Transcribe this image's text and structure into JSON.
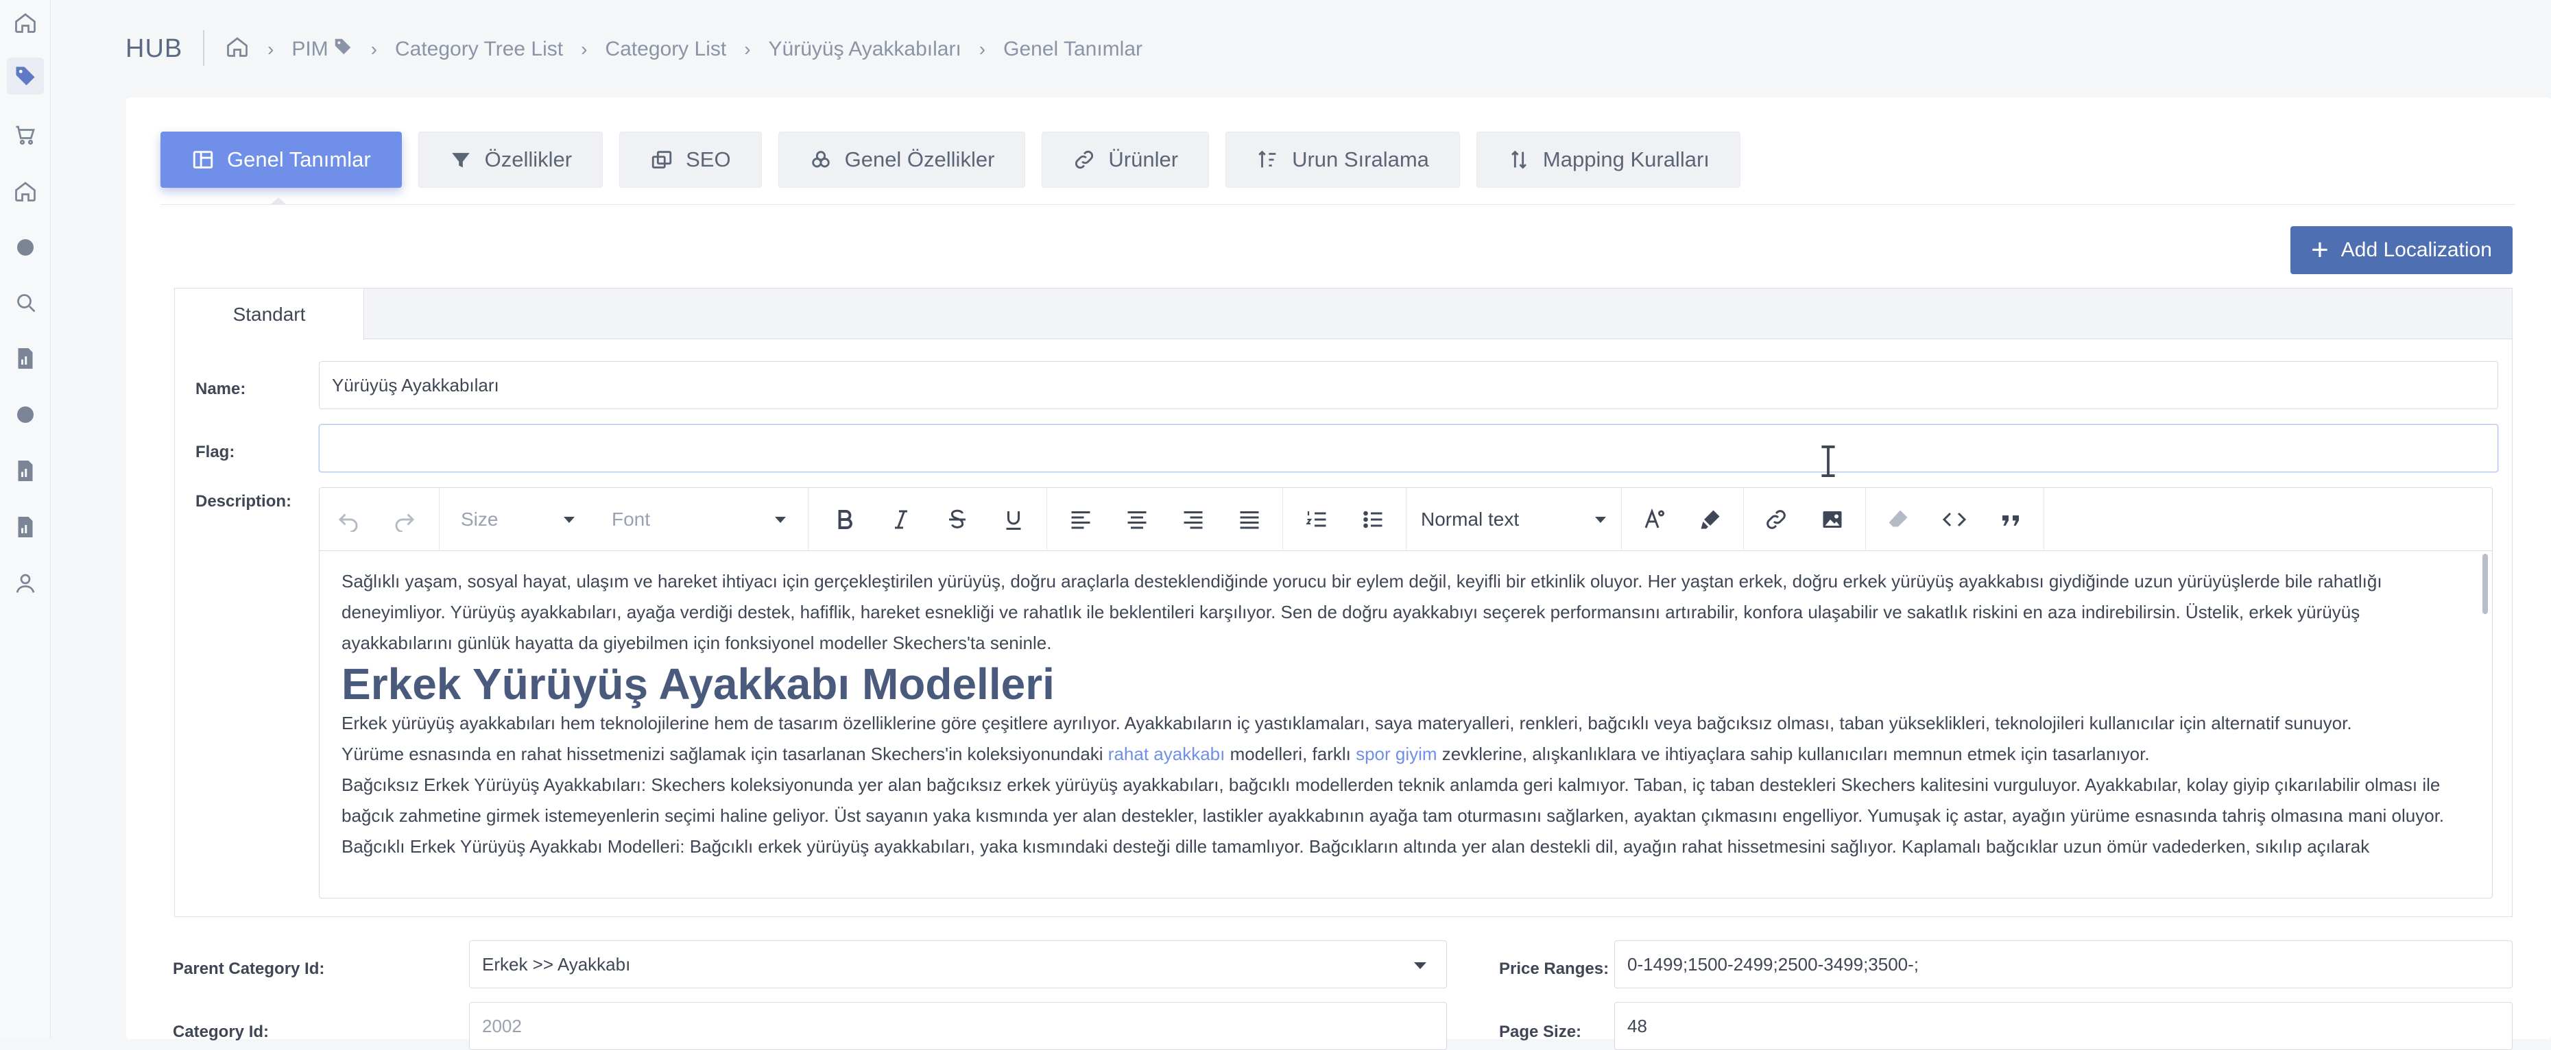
{
  "rail": {
    "items": [
      {
        "icon": "home-icon",
        "active": false
      },
      {
        "icon": "tag-icon",
        "active": true
      },
      {
        "icon": "cart-icon",
        "active": false
      },
      {
        "icon": "home-icon",
        "active": false
      },
      {
        "icon": "circle-icon",
        "active": false
      },
      {
        "icon": "search-icon",
        "active": false
      },
      {
        "icon": "report-icon",
        "active": false
      },
      {
        "icon": "circle-icon",
        "active": false
      },
      {
        "icon": "report-icon",
        "active": false
      },
      {
        "icon": "report-icon",
        "active": false
      },
      {
        "icon": "user-icon",
        "active": false
      }
    ]
  },
  "header": {
    "brand": "HUB",
    "breadcrumb": [
      "PIM",
      "Category Tree List",
      "Category List",
      "Yürüyüş Ayakkabıları",
      "Genel Tanımlar"
    ]
  },
  "tabs": [
    {
      "label": "Genel Tanımlar",
      "icon": "layout-icon",
      "active": true
    },
    {
      "label": "Özellikler",
      "icon": "filter-icon",
      "active": false
    },
    {
      "label": "SEO",
      "icon": "copy-icon",
      "active": false
    },
    {
      "label": "Genel Özellikler",
      "icon": "shapes-icon",
      "active": false
    },
    {
      "label": "Ürünler",
      "icon": "link-icon",
      "active": false
    },
    {
      "label": "Urun Sıralama",
      "icon": "sort-icon",
      "active": false
    },
    {
      "label": "Mapping Kuralları",
      "icon": "sort-arrows-icon",
      "active": false
    }
  ],
  "add_localization": "Add Localization",
  "localization": {
    "tab": "Standart",
    "name_label": "Name:",
    "name_value": "Yürüyüş Ayakkabıları",
    "flag_label": "Flag:",
    "flag_value": "",
    "description_label": "Description:",
    "toolbar": {
      "size": "Size",
      "font": "Font",
      "block": "Normal text"
    },
    "description": {
      "p1": "Sağlıklı yaşam, sosyal hayat, ulaşım ve hareket ihtiyacı için gerçekleştirilen yürüyüş, doğru araçlarla desteklendiğinde yorucu bir eylem değil, keyifli bir etkinlik oluyor. Her yaştan erkek, doğru erkek yürüyüş ayakkabısı giydiğinde uzun yürüyüşlerde bile rahatlığı deneyimliyor. Yürüyüş ayakkabıları, ayağa verdiği destek, hafiflik, hareket esnekliği ve rahatlık ile beklentileri karşılıyor. Sen de doğru ayakkabıyı seçerek performansını artırabilir, konfora ulaşabilir ve sakatlık riskini en aza indirebilirsin. Üstelik, erkek yürüyüş ayakkabılarını günlük hayatta da giyebilmen için fonksiyonel modeller Skechers'ta seninle.",
      "h2": "Erkek Yürüyüş Ayakkabı Modelleri",
      "p2": "Erkek yürüyüş ayakkabıları hem teknolojilerine hem de tasarım özelliklerine göre çeşitlere ayrılıyor. Ayakkabıların iç yastıklamaları, saya materyalleri, renkleri, bağcıklı veya bağcıksız olması, taban yükseklikleri, teknolojileri kullanıcılar için alternatif sunuyor.",
      "p3_a": "Yürüme esnasında en rahat hissetmenizi sağlamak için tasarlanan Skechers'in koleksiyonundaki ",
      "p3_link1": "rahat ayakkabı",
      "p3_b": " modelleri, farklı ",
      "p3_link2": "spor giyim",
      "p3_c": " zevklerine, alışkanlıklara ve ihtiyaçlara sahip kullanıcıları memnun etmek için tasarlanıyor.",
      "p4": "Bağcıksız Erkek Yürüyüş Ayakkabıları: Skechers koleksiyonunda yer alan bağcıksız erkek yürüyüş ayakkabıları, bağcıklı modellerden teknik anlamda geri kalmıyor. Taban, iç taban destekleri Skechers kalitesini vurguluyor. Ayakkabılar, kolay giyip çıkarılabilir olması ile bağcık zahmetine girmek istemeyenlerin seçimi haline geliyor. Üst sayanın yaka kısmında yer alan destekler, lastikler ayakkabının ayağa tam oturmasını sağlarken, ayaktan çıkmasını engelliyor. Yumuşak iç astar, ayağın yürüme esnasında tahriş olmasına mani oluyor.",
      "p5": "Bağcıklı Erkek Yürüyüş Ayakkabı Modelleri: Bağcıklı erkek yürüyüş ayakkabıları, yaka kısmındaki desteği dille tamamlıyor. Bağcıkların altında yer alan destekli dil, ayağın rahat hissetmesini sağlıyor. Kaplamalı bağcıklar uzun ömür vadederken, sıkılıp açılarak"
    }
  },
  "form": {
    "parent_label": "Parent Category Id:",
    "parent_value": "Erkek >> Ayakkabı",
    "price_label": "Price Ranges:",
    "price_value": "0-1499;1500-2499;2500-3499;3500-;",
    "category_id_label": "Category Id:",
    "category_id_value": "2002",
    "page_size_label": "Page Size:",
    "page_size_value": "48"
  },
  "colors": {
    "accent": "#6f8fe8",
    "primary_button": "#4f6fb3",
    "heading": "#4a5a7c"
  }
}
